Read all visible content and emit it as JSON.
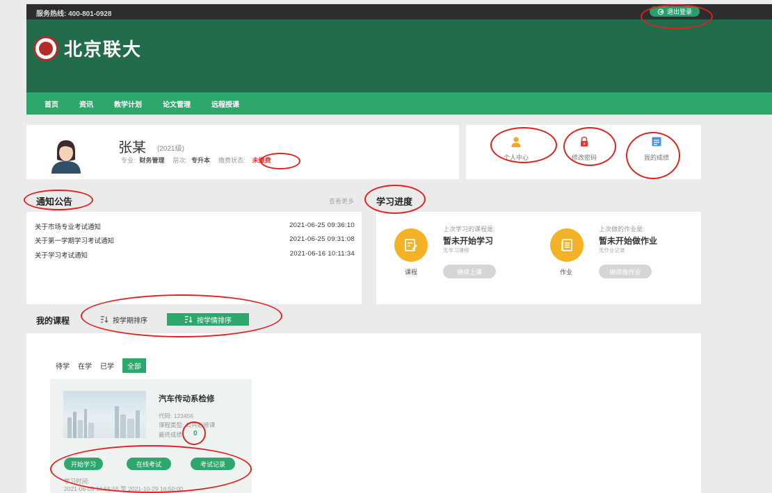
{
  "topbar": {
    "hotline": "服务热线: 400-801-0928",
    "logout_label": "退出登录"
  },
  "header": {
    "logo_text": "北京联大",
    "nav": [
      "首页",
      "资讯",
      "教学计划",
      "论文管理",
      "远程授课"
    ]
  },
  "profile": {
    "name": "张某",
    "grade": "(2021级)",
    "major_label": "专业:",
    "major_value": "财务管理",
    "level_label": "层次:",
    "level_value": "专升本",
    "fee_label": "缴费状态:",
    "fee_value": "未缴费"
  },
  "quick_links": [
    {
      "label": "个人中心",
      "icon": "user-icon",
      "color": "#f5a623"
    },
    {
      "label": "修改密码",
      "icon": "lock-icon",
      "color": "#e53935"
    },
    {
      "label": "我的成绩",
      "icon": "grades-icon",
      "color": "#4a90d9"
    }
  ],
  "notice": {
    "title": "通知公告",
    "view_more": "查看更多",
    "items": [
      {
        "title": "关于市场专业考试通知",
        "date": "2021-06-25 09:36:10"
      },
      {
        "title": "关于第一学期学习考试通知",
        "date": "2021-06-25 09:31:08"
      },
      {
        "title": "关于学习考试通知",
        "date": "2021-06-16 10:11:34"
      }
    ]
  },
  "progress": {
    "title": "学习进度",
    "course": {
      "circle_label": "课程",
      "last_label": "上次学习的课程是:",
      "main": "暂未开始学习",
      "sub": "无学习课程",
      "button": "继续上课"
    },
    "homework": {
      "circle_label": "作业",
      "last_label": "上次做的作业是:",
      "main": "暂未开始做作业",
      "sub": "无作业记录",
      "button": "继续做作业"
    }
  },
  "courses": {
    "title": "我的课程",
    "sort_term": "按学期排序",
    "sort_status": "按学情排序",
    "filters": [
      "待学",
      "在学",
      "已学",
      "全部"
    ],
    "active_filter": "全部",
    "card": {
      "name": "汽车传动系检修",
      "code": "代码: 123456",
      "category": "课程类型: 公共必修课",
      "score_label": "最终成绩:",
      "score": "0",
      "buttons": [
        "开始学习",
        "在线考试",
        "考试记录"
      ],
      "time_label": "学习时间:",
      "time_value": "2021-06-09 16:55:55 至 2021-10-29 16:50:00"
    }
  },
  "colors": {
    "header_green": "#226b4b",
    "nav_green": "#2ea76c",
    "accent_orange": "#f5b227",
    "annotation_red": "#e0221f"
  }
}
